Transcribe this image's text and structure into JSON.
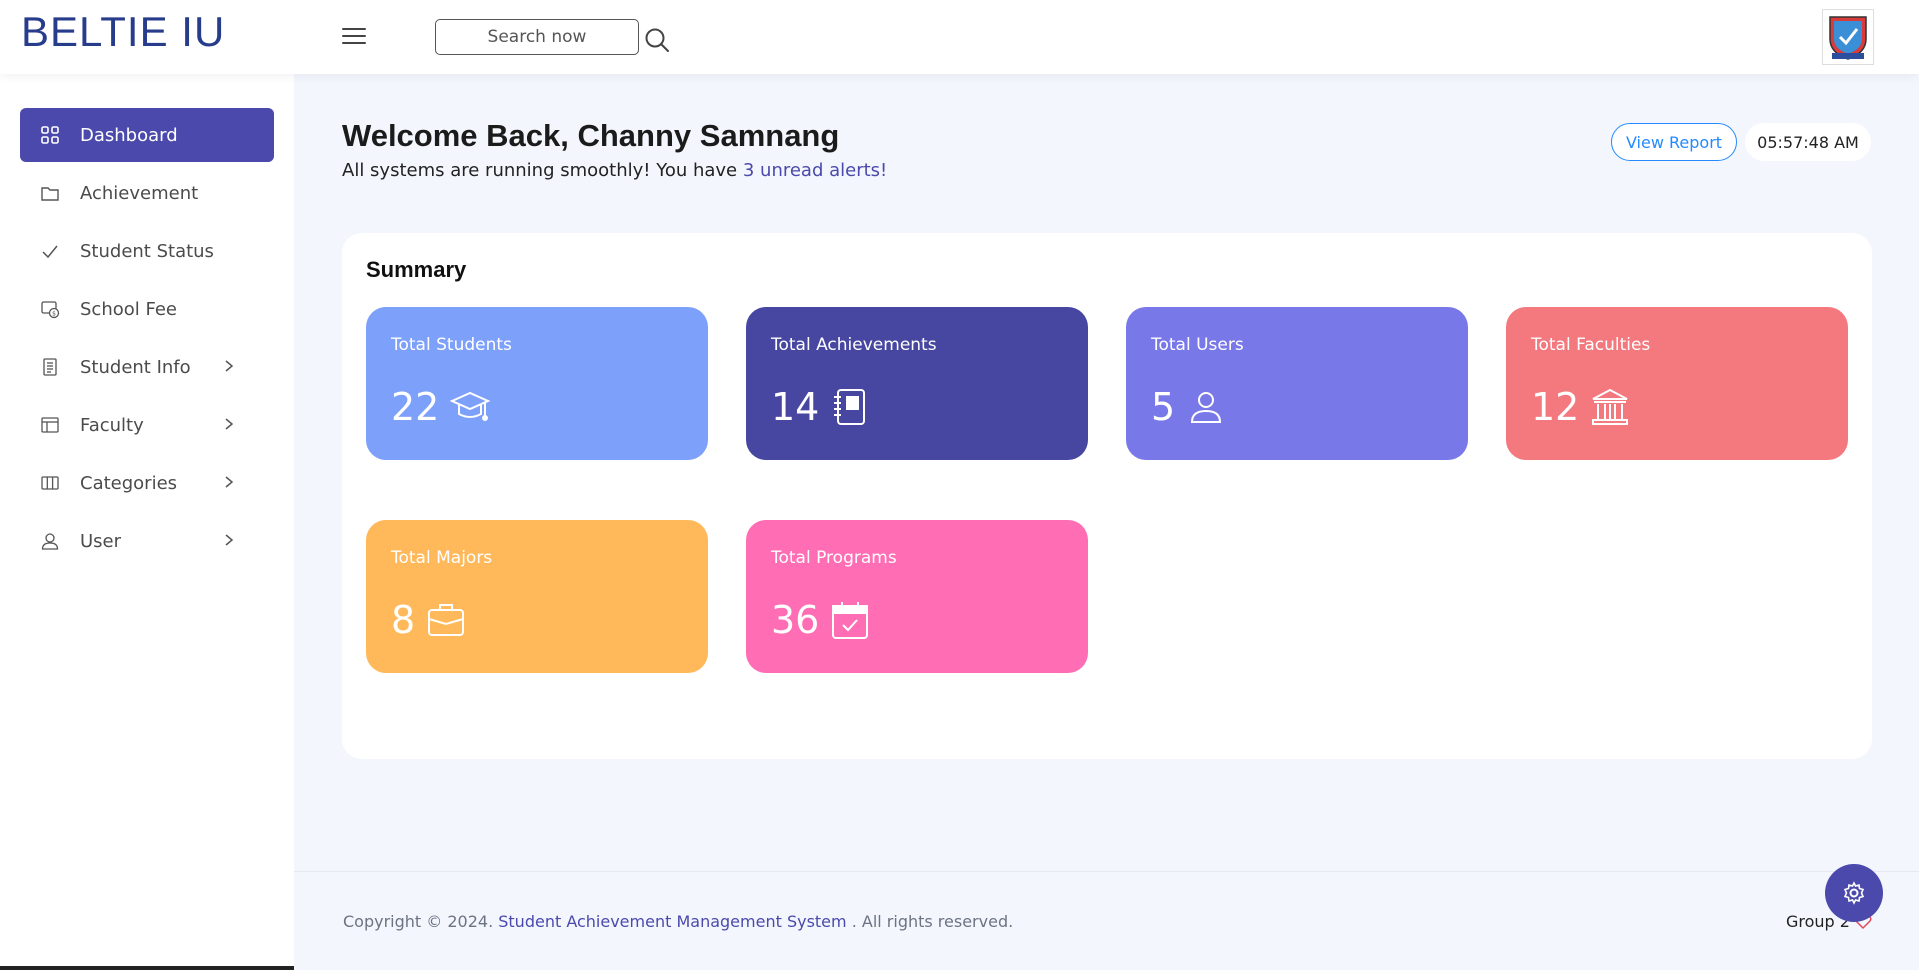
{
  "brand": "BELTIE IU",
  "search": {
    "placeholder": "Search now"
  },
  "sidebar": {
    "items": [
      {
        "label": "Dashboard",
        "icon": "grid-icon",
        "active": true,
        "has_submenu": false
      },
      {
        "label": "Achievement",
        "icon": "folder-icon",
        "active": false,
        "has_submenu": false
      },
      {
        "label": "Student Status",
        "icon": "check-icon",
        "active": false,
        "has_submenu": false
      },
      {
        "label": "School Fee",
        "icon": "money-icon",
        "active": false,
        "has_submenu": false
      },
      {
        "label": "Student Info",
        "icon": "document-icon",
        "active": false,
        "has_submenu": true
      },
      {
        "label": "Faculty",
        "icon": "layout-icon",
        "active": false,
        "has_submenu": true
      },
      {
        "label": "Categories",
        "icon": "columns-icon",
        "active": false,
        "has_submenu": true
      },
      {
        "label": "User",
        "icon": "user-icon",
        "active": false,
        "has_submenu": true
      }
    ]
  },
  "header": {
    "welcome": "Welcome Back, Channy Samnang",
    "subtitle_prefix": "All systems are running smoothly! You have ",
    "alerts_link": "3 unread alerts!",
    "view_report": "View Report",
    "clock": "05:57:48 AM"
  },
  "summary": {
    "title": "Summary",
    "cards": [
      {
        "label": "Total Students",
        "value": "22",
        "icon": "graduation-cap-icon",
        "color": "#7da0fa"
      },
      {
        "label": "Total Achievements",
        "value": "14",
        "icon": "notebook-icon",
        "color": "#4747a1"
      },
      {
        "label": "Total Users",
        "value": "5",
        "icon": "user-icon",
        "color": "#7978e9"
      },
      {
        "label": "Total Faculties",
        "value": "12",
        "icon": "bank-icon",
        "color": "#f3797e"
      },
      {
        "label": "Total Majors",
        "value": "8",
        "icon": "briefcase-icon",
        "color": "#ffb95a"
      },
      {
        "label": "Total Programs",
        "value": "36",
        "icon": "calendar-check-icon",
        "color": "#ff6eb4"
      }
    ]
  },
  "footer": {
    "copyright_prefix": "Copyright © 2024. ",
    "copyright_link": "Student Achievement Management System",
    "copyright_suffix": " . All rights reserved.",
    "group": "Group 2"
  },
  "colors": {
    "accent": "#4b49ac",
    "link_blue": "#248afd",
    "brand": "#283c8c"
  }
}
